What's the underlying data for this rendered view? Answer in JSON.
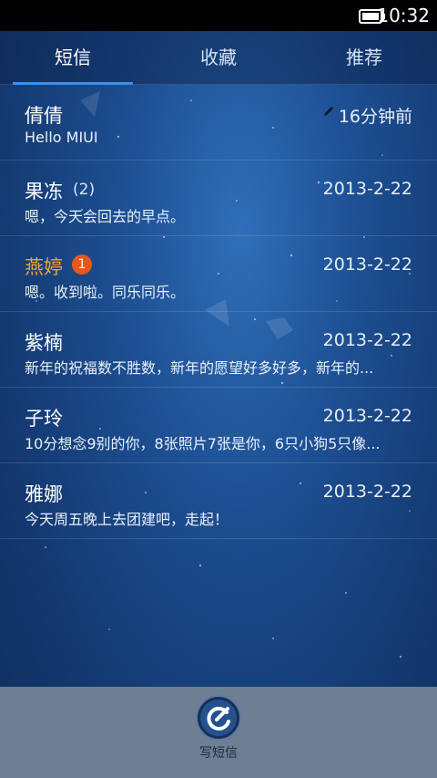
{
  "status_bar": {
    "time": "10:32"
  },
  "tabs": [
    {
      "label": "短信"
    },
    {
      "label": "收藏"
    },
    {
      "label": "推荐"
    }
  ],
  "threads": [
    {
      "name": "倩倩",
      "count": "",
      "badge": "",
      "date": "16分钟前",
      "snippet": "Hello MIUI",
      "draft": true
    },
    {
      "name": "果冻",
      "count": "(2)",
      "badge": "",
      "date": "2013-2-22",
      "snippet": "嗯，今天会回去的早点。"
    },
    {
      "name": "燕婷",
      "count": "",
      "badge": "1",
      "date": "2013-2-22",
      "snippet": "嗯。收到啦。同乐同乐。",
      "unread": true
    },
    {
      "name": "紫楠",
      "count": "",
      "badge": "",
      "date": "2013-2-22",
      "snippet": "新年的祝福数不胜数，新年的愿望好多好多，新年的..."
    },
    {
      "name": "子玲",
      "count": "",
      "badge": "",
      "date": "2013-2-22",
      "snippet": "10分想念9别的你，8张照片7张是你，6只小狗5只像..."
    },
    {
      "name": "雅娜",
      "count": "",
      "badge": "",
      "date": "2013-2-22",
      "snippet": "今天周五晚上去团建吧，走起！"
    }
  ],
  "bottom_bar": {
    "compose_label": "写短信"
  },
  "colors": {
    "accent": "#3f8fe8",
    "unread_name": "#f5a033",
    "badge": "#e8561c",
    "bottom_bar": "#6f7f93"
  }
}
